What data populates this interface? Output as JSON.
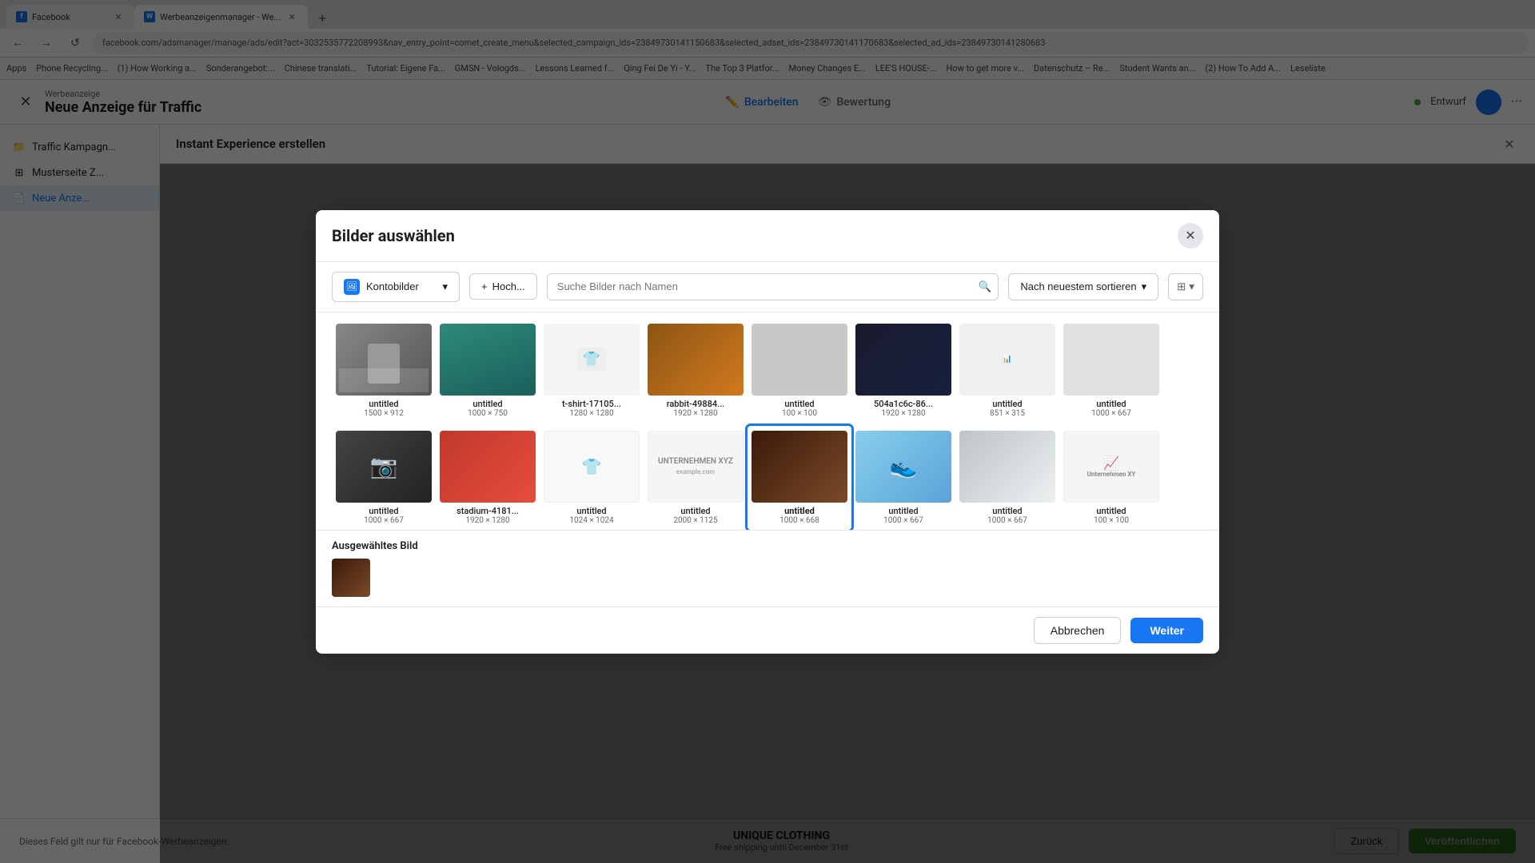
{
  "browser": {
    "tabs": [
      {
        "id": "fb",
        "favicon": "f",
        "title": "Facebook",
        "active": false
      },
      {
        "id": "werbung",
        "favicon": "w",
        "title": "Werbeanzeigenmanager - We...",
        "active": true
      }
    ],
    "new_tab_label": "+",
    "address": "facebook.com/adsmanager/manage/ads/edit?act=3032535772208993&nav_entry_point=comet_create_menu&selected_campaign_ids=23849730141150683&selected_adset_ids=23849730141170683&selected_ad_ids=23849730141280683",
    "bookmarks": [
      "Apps",
      "Phone Recycling...",
      "(1) How Working a...",
      "Sonderangebot:...",
      "Chinese translati...",
      "Tutorial: Eigene Fa...",
      "GMSN - Vologds...",
      "Lessons Learned f...",
      "Qing Fei De Yi-Y...",
      "The Top 3 Platfor...",
      "Money Changes E...",
      "LEE'S HOUSE-...",
      "How to get more v...",
      "Datenschutz – Re...",
      "Student Wants an...",
      "(2) How To Add A...",
      "Leseliste"
    ]
  },
  "page": {
    "sidebar_section": "Werbeanzeige",
    "main_title": "Neue Anzeige für Traffic",
    "nav_tabs": [
      {
        "id": "bearbeiten",
        "label": "Bearbeiten",
        "icon": "✏️"
      },
      {
        "id": "bewertung",
        "label": "Bewertung",
        "icon": "👁"
      }
    ],
    "status": "Entwurf",
    "sidebar_items": [
      {
        "id": "traffic",
        "label": "Traffic Kampagn...",
        "icon": "📁"
      },
      {
        "id": "musterseite",
        "label": "Musterseite Z...",
        "icon": "⊞"
      },
      {
        "id": "neue-anzeige",
        "label": "Neue Anze...",
        "icon": "📄",
        "active": true
      }
    ]
  },
  "instant_experience": {
    "title": "Instant Experience erstellen"
  },
  "modal": {
    "title": "Bilder auswählen",
    "dropdown_label": "Kontobilder",
    "upload_label": "Hoch...",
    "search_placeholder": "Suche Bilder nach Namen",
    "sort_label": "Nach neuestem sortieren",
    "images_row1": [
      {
        "id": "img1",
        "name": "untitled",
        "size": "1500 × 912",
        "bg": "gray-person"
      },
      {
        "id": "img2",
        "name": "untitled",
        "size": "1000 × 750",
        "bg": "teal"
      },
      {
        "id": "img3",
        "name": "t-shirt-17105...",
        "size": "1280 × 1280",
        "bg": "tshirt"
      },
      {
        "id": "img4",
        "name": "rabbit-49884...",
        "size": "1920 × 1280",
        "bg": "rabbit"
      },
      {
        "id": "img5",
        "name": "untitled",
        "size": "100 × 100",
        "bg": "small-gray"
      },
      {
        "id": "img6",
        "name": "504a1c6c-86...",
        "size": "1920 × 1280",
        "bg": "dark"
      },
      {
        "id": "img7",
        "name": "untitled",
        "size": "851 × 315",
        "bg": "logo"
      },
      {
        "id": "img8",
        "name": "untitled",
        "size": "1000 × 667",
        "bg": "untitled-last"
      }
    ],
    "images_row2": [
      {
        "id": "img9",
        "name": "untitled",
        "size": "1000 × 667",
        "bg": "camera",
        "selected": false
      },
      {
        "id": "img10",
        "name": "stadium-4181...",
        "size": "1920 × 1280",
        "bg": "stadium",
        "selected": false
      },
      {
        "id": "img11",
        "name": "untitled",
        "size": "1024 × 1024",
        "bg": "tshirt2",
        "selected": false
      },
      {
        "id": "img12",
        "name": "untitled",
        "size": "2000 × 1125",
        "bg": "xyz",
        "selected": false
      },
      {
        "id": "img13",
        "name": "untitled",
        "size": "1000 × 668",
        "bg": "chocolate",
        "selected": true
      },
      {
        "id": "img14",
        "name": "untitled",
        "size": "1000 × 667",
        "bg": "shoe",
        "selected": false
      },
      {
        "id": "img15",
        "name": "untitled",
        "size": "1000 × 667",
        "bg": "business",
        "selected": false
      },
      {
        "id": "img16",
        "name": "untitled",
        "size": "100 × 100",
        "bg": "logo2",
        "selected": false
      }
    ],
    "selected_section_label": "Ausgewähltes Bild",
    "cancel_label": "Abbrechen",
    "weiter_label": "Weiter"
  },
  "bottom_bar": {
    "field_note": "Dieses Feld gilt nur für Facebook-Werbeanzeigen.",
    "brand_title": "UNIQUE CLOTHING",
    "brand_subtitle": "Free shipping until December 31st",
    "back_label": "Zurück",
    "publish_label": "Veröffentlichen"
  }
}
